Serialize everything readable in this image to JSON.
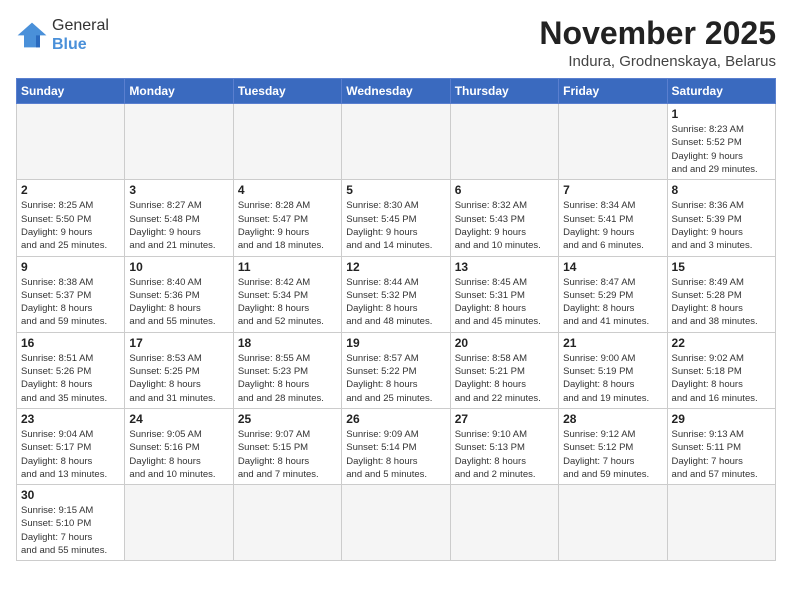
{
  "header": {
    "logo_general": "General",
    "logo_blue": "Blue",
    "month_title": "November 2025",
    "location": "Indura, Grodnenskaya, Belarus"
  },
  "days_of_week": [
    "Sunday",
    "Monday",
    "Tuesday",
    "Wednesday",
    "Thursday",
    "Friday",
    "Saturday"
  ],
  "weeks": [
    [
      null,
      null,
      null,
      null,
      null,
      null,
      {
        "day": "1",
        "sunrise": "Sunrise: 8:23 AM",
        "sunset": "Sunset: 5:52 PM",
        "daylight": "Daylight: 9 hours and 29 minutes."
      }
    ],
    [
      {
        "day": "2",
        "sunrise": "Sunrise: 8:25 AM",
        "sunset": "Sunset: 5:50 PM",
        "daylight": "Daylight: 9 hours and 25 minutes."
      },
      {
        "day": "3",
        "sunrise": "Sunrise: 8:27 AM",
        "sunset": "Sunset: 5:48 PM",
        "daylight": "Daylight: 9 hours and 21 minutes."
      },
      {
        "day": "4",
        "sunrise": "Sunrise: 8:28 AM",
        "sunset": "Sunset: 5:47 PM",
        "daylight": "Daylight: 9 hours and 18 minutes."
      },
      {
        "day": "5",
        "sunrise": "Sunrise: 8:30 AM",
        "sunset": "Sunset: 5:45 PM",
        "daylight": "Daylight: 9 hours and 14 minutes."
      },
      {
        "day": "6",
        "sunrise": "Sunrise: 8:32 AM",
        "sunset": "Sunset: 5:43 PM",
        "daylight": "Daylight: 9 hours and 10 minutes."
      },
      {
        "day": "7",
        "sunrise": "Sunrise: 8:34 AM",
        "sunset": "Sunset: 5:41 PM",
        "daylight": "Daylight: 9 hours and 6 minutes."
      },
      {
        "day": "8",
        "sunrise": "Sunrise: 8:36 AM",
        "sunset": "Sunset: 5:39 PM",
        "daylight": "Daylight: 9 hours and 3 minutes."
      }
    ],
    [
      {
        "day": "9",
        "sunrise": "Sunrise: 8:38 AM",
        "sunset": "Sunset: 5:37 PM",
        "daylight": "Daylight: 8 hours and 59 minutes."
      },
      {
        "day": "10",
        "sunrise": "Sunrise: 8:40 AM",
        "sunset": "Sunset: 5:36 PM",
        "daylight": "Daylight: 8 hours and 55 minutes."
      },
      {
        "day": "11",
        "sunrise": "Sunrise: 8:42 AM",
        "sunset": "Sunset: 5:34 PM",
        "daylight": "Daylight: 8 hours and 52 minutes."
      },
      {
        "day": "12",
        "sunrise": "Sunrise: 8:44 AM",
        "sunset": "Sunset: 5:32 PM",
        "daylight": "Daylight: 8 hours and 48 minutes."
      },
      {
        "day": "13",
        "sunrise": "Sunrise: 8:45 AM",
        "sunset": "Sunset: 5:31 PM",
        "daylight": "Daylight: 8 hours and 45 minutes."
      },
      {
        "day": "14",
        "sunrise": "Sunrise: 8:47 AM",
        "sunset": "Sunset: 5:29 PM",
        "daylight": "Daylight: 8 hours and 41 minutes."
      },
      {
        "day": "15",
        "sunrise": "Sunrise: 8:49 AM",
        "sunset": "Sunset: 5:28 PM",
        "daylight": "Daylight: 8 hours and 38 minutes."
      }
    ],
    [
      {
        "day": "16",
        "sunrise": "Sunrise: 8:51 AM",
        "sunset": "Sunset: 5:26 PM",
        "daylight": "Daylight: 8 hours and 35 minutes."
      },
      {
        "day": "17",
        "sunrise": "Sunrise: 8:53 AM",
        "sunset": "Sunset: 5:25 PM",
        "daylight": "Daylight: 8 hours and 31 minutes."
      },
      {
        "day": "18",
        "sunrise": "Sunrise: 8:55 AM",
        "sunset": "Sunset: 5:23 PM",
        "daylight": "Daylight: 8 hours and 28 minutes."
      },
      {
        "day": "19",
        "sunrise": "Sunrise: 8:57 AM",
        "sunset": "Sunset: 5:22 PM",
        "daylight": "Daylight: 8 hours and 25 minutes."
      },
      {
        "day": "20",
        "sunrise": "Sunrise: 8:58 AM",
        "sunset": "Sunset: 5:21 PM",
        "daylight": "Daylight: 8 hours and 22 minutes."
      },
      {
        "day": "21",
        "sunrise": "Sunrise: 9:00 AM",
        "sunset": "Sunset: 5:19 PM",
        "daylight": "Daylight: 8 hours and 19 minutes."
      },
      {
        "day": "22",
        "sunrise": "Sunrise: 9:02 AM",
        "sunset": "Sunset: 5:18 PM",
        "daylight": "Daylight: 8 hours and 16 minutes."
      }
    ],
    [
      {
        "day": "23",
        "sunrise": "Sunrise: 9:04 AM",
        "sunset": "Sunset: 5:17 PM",
        "daylight": "Daylight: 8 hours and 13 minutes."
      },
      {
        "day": "24",
        "sunrise": "Sunrise: 9:05 AM",
        "sunset": "Sunset: 5:16 PM",
        "daylight": "Daylight: 8 hours and 10 minutes."
      },
      {
        "day": "25",
        "sunrise": "Sunrise: 9:07 AM",
        "sunset": "Sunset: 5:15 PM",
        "daylight": "Daylight: 8 hours and 7 minutes."
      },
      {
        "day": "26",
        "sunrise": "Sunrise: 9:09 AM",
        "sunset": "Sunset: 5:14 PM",
        "daylight": "Daylight: 8 hours and 5 minutes."
      },
      {
        "day": "27",
        "sunrise": "Sunrise: 9:10 AM",
        "sunset": "Sunset: 5:13 PM",
        "daylight": "Daylight: 8 hours and 2 minutes."
      },
      {
        "day": "28",
        "sunrise": "Sunrise: 9:12 AM",
        "sunset": "Sunset: 5:12 PM",
        "daylight": "Daylight: 7 hours and 59 minutes."
      },
      {
        "day": "29",
        "sunrise": "Sunrise: 9:13 AM",
        "sunset": "Sunset: 5:11 PM",
        "daylight": "Daylight: 7 hours and 57 minutes."
      }
    ],
    [
      {
        "day": "30",
        "sunrise": "Sunrise: 9:15 AM",
        "sunset": "Sunset: 5:10 PM",
        "daylight": "Daylight: 7 hours and 55 minutes."
      },
      null,
      null,
      null,
      null,
      null,
      null
    ]
  ]
}
